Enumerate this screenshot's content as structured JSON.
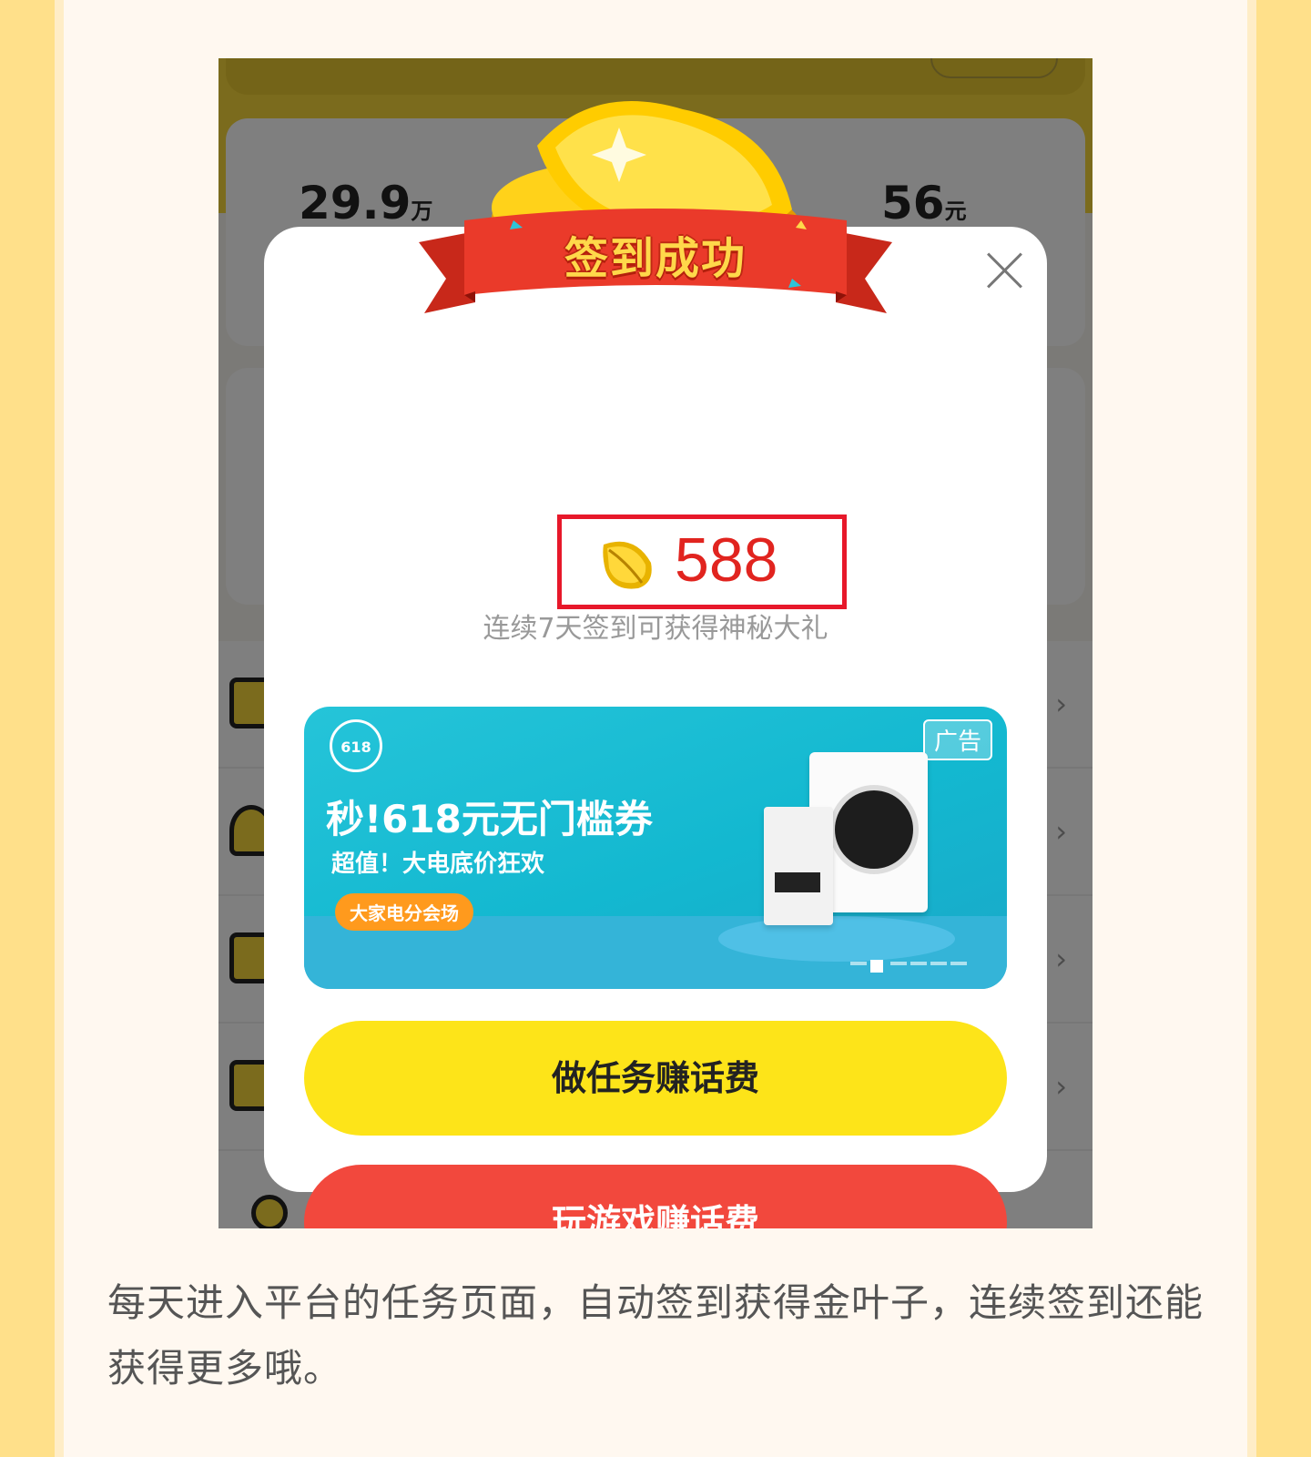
{
  "background": {
    "stat_left_value": "29.9",
    "stat_left_unit": "万",
    "stat_right_value": "56",
    "stat_right_unit": "元",
    "list_chevron": "›"
  },
  "dialog": {
    "ribbon_title": "签到成功",
    "close_icon": "close-icon",
    "reward_icon": "gold-leaf-icon",
    "reward_value": "588",
    "subtext": "连续7天签到可获得神秘大礼",
    "ad": {
      "badge": "618",
      "label": "广告",
      "headline": "秒!618元无门槛券",
      "subheadline": "超值！大电底价狂欢",
      "cta": "大家电分会场",
      "slides_total": 6,
      "active_slide": 2
    },
    "task_button": "做任务赚话费",
    "game_button": "玩游戏赚话费"
  },
  "caption": "每天进入平台的任务页面，自动签到获得金叶子，连续签到还能获得更多哦。",
  "colors": {
    "page_bg": "#ffe08a",
    "accent_red": "#e1241f",
    "task_yellow": "#fde419",
    "game_red": "#f2483d",
    "ad_cyan": "#13b8d0"
  }
}
